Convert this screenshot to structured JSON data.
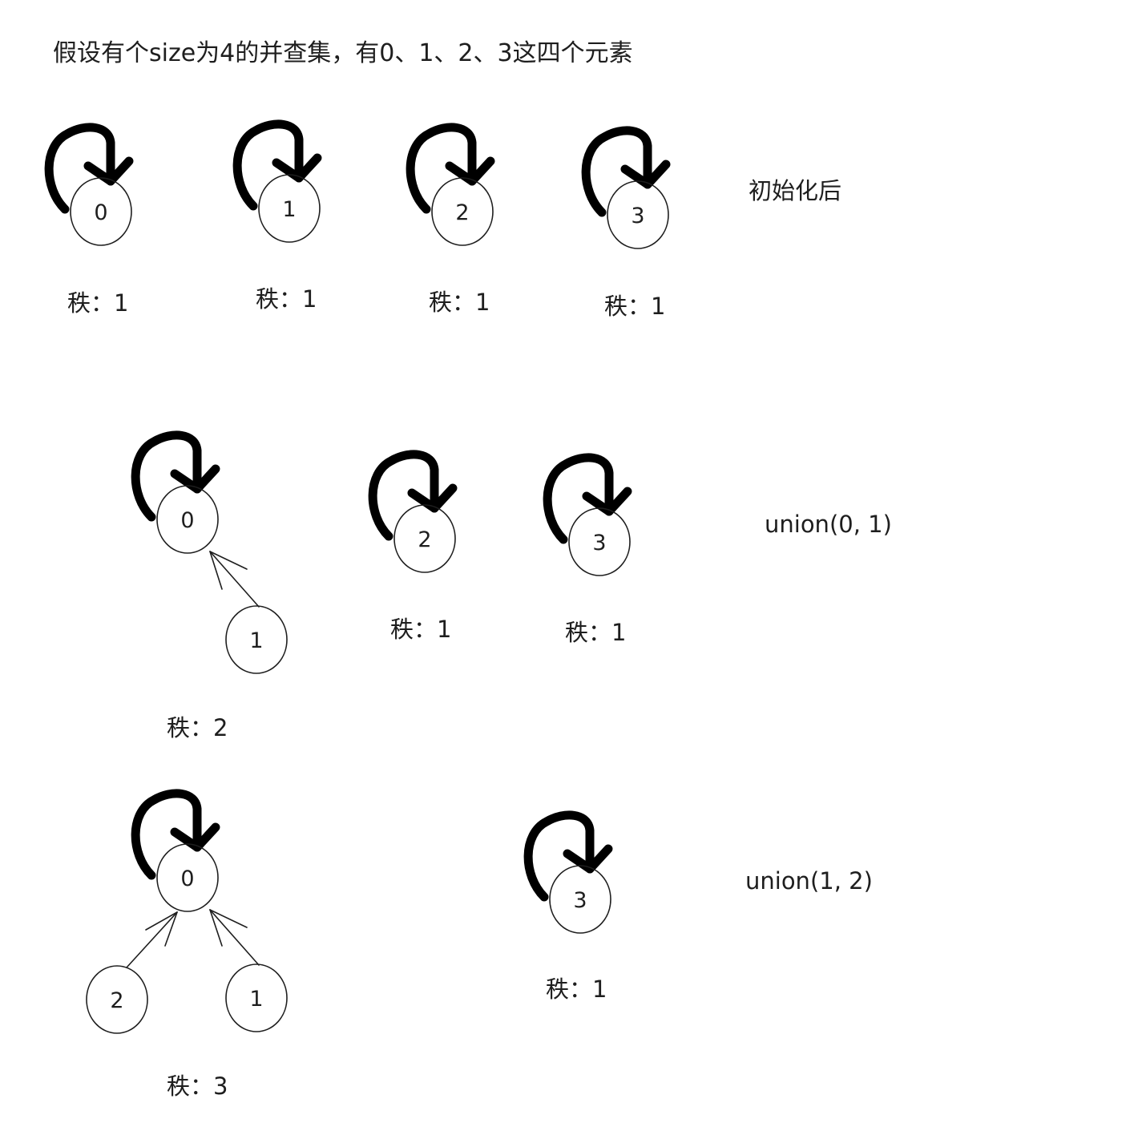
{
  "title": "假设有个size为4的并查集，有0、1、2、3这四个元素",
  "stages": [
    {
      "operation": "初始化后",
      "ranks": [
        "秩：1",
        "秩：1",
        "秩：1",
        "秩：1"
      ],
      "nodes": [
        "0",
        "1",
        "2",
        "3"
      ]
    },
    {
      "operation": "union(0, 1)",
      "ranks": [
        "秩：2",
        "秩：1",
        "秩：1"
      ],
      "nodes": [
        "0",
        "1",
        "2",
        "3"
      ]
    },
    {
      "operation": "union(1, 2)",
      "ranks": [
        "秩：3",
        "秩：1"
      ],
      "nodes": [
        "0",
        "2",
        "1",
        "3"
      ]
    }
  ],
  "colors": {
    "stroke": "#1e1e1e",
    "loop": "#000000",
    "background": "#ffffff"
  }
}
